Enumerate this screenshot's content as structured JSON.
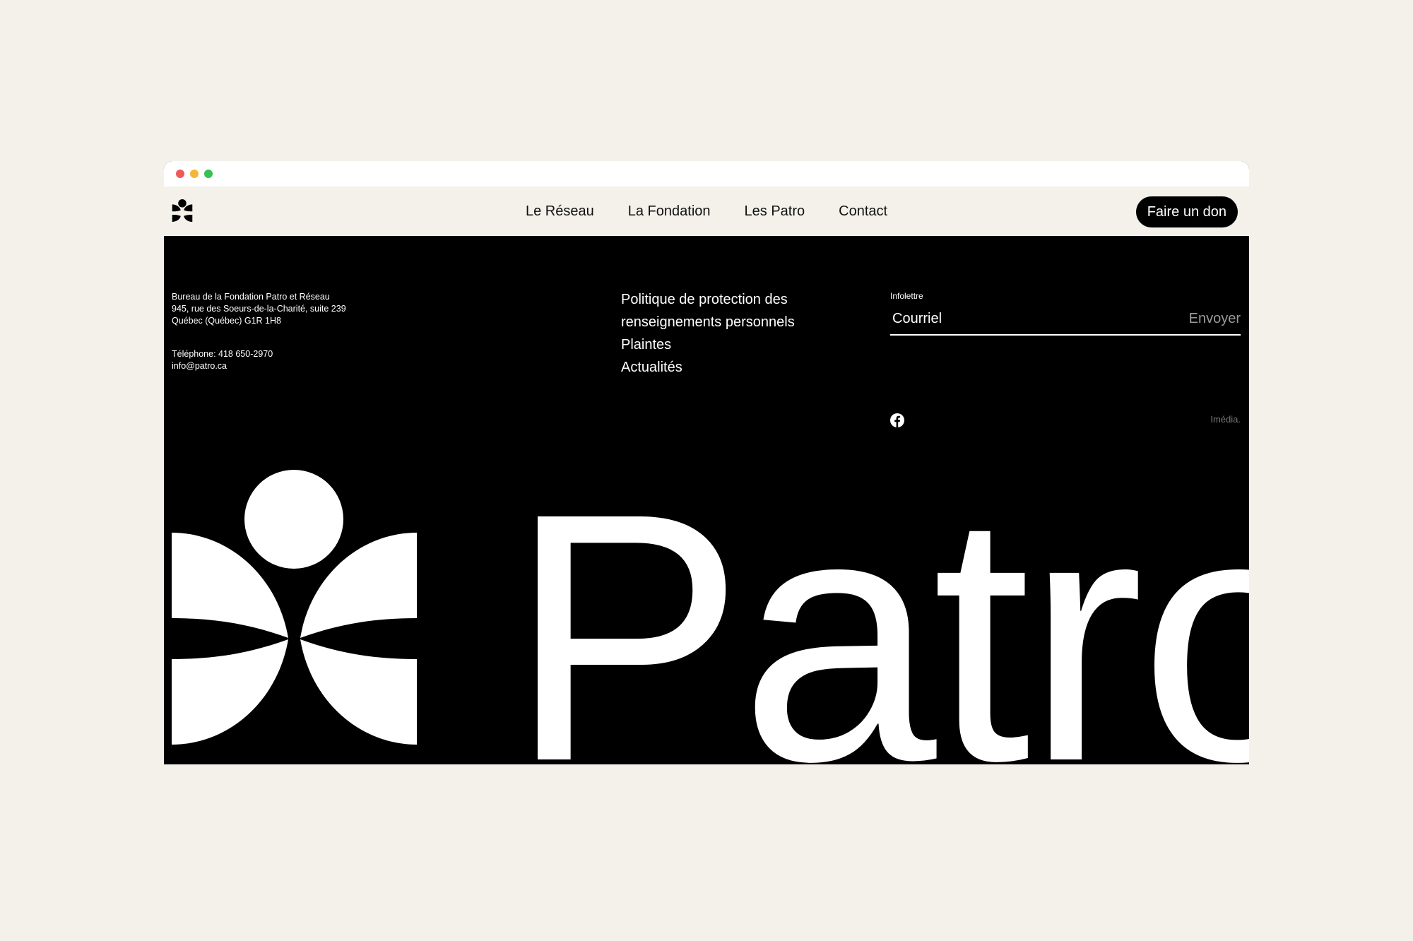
{
  "window": {
    "controls": [
      "close",
      "minimize",
      "maximize"
    ]
  },
  "nav": {
    "logo_icon": "patro-logo-icon",
    "links": [
      "Le Réseau",
      "La Fondation",
      "Les Patro",
      "Contact"
    ],
    "donate_label": "Faire un don"
  },
  "footer": {
    "address_lines": [
      "Bureau de la Fondation Patro et Réseau",
      "945, rue des Soeurs-de-la-Charité, suite 239",
      "Québec (Québec) G1R 1H8"
    ],
    "phone": "Téléphone: 418 650-2970",
    "email": "info@patro.ca",
    "links": [
      "Politique de protection des renseignements personnels",
      "Plaintes",
      "Actualités"
    ],
    "newsletter": {
      "label": "Infolettre",
      "placeholder": "Courriel",
      "submit_label": "Envoyer"
    },
    "social_icon": "facebook-icon",
    "credit": "Imédia.",
    "wordmark": "Patro"
  },
  "colors": {
    "background": "#f3f1ea",
    "footer": "#000000",
    "text_light": "#ffffff",
    "muted": "#9a9a9a"
  }
}
